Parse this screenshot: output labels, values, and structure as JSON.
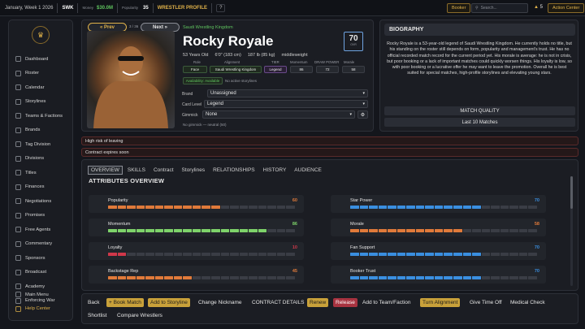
{
  "topbar": {
    "date": "January, Week 1 2026",
    "promotion": "SWK",
    "money_label": "Money",
    "money_value": "$30.0M",
    "popularity_label": "Popularity",
    "popularity_value": "35",
    "section": "WRESTLER PROFILE",
    "help": "?",
    "booker": "Booker",
    "search_placeholder": "Search...",
    "notif_count": "5",
    "action_center": "Action Center"
  },
  "sidebar": {
    "items": [
      {
        "label": "Dashboard",
        "icon": "home-icon"
      },
      {
        "label": "Roster",
        "icon": "roster-icon"
      },
      {
        "label": "Calendar",
        "icon": "calendar-icon"
      },
      {
        "label": "Storylines",
        "icon": "storylines-icon"
      },
      {
        "label": "Teams & Factions",
        "icon": "teams-icon"
      },
      {
        "label": "Brands",
        "icon": "brands-icon"
      },
      {
        "label": "Tag Division",
        "icon": "tag-icon"
      },
      {
        "label": "Divisions",
        "icon": "divisions-icon"
      },
      {
        "label": "Titles",
        "icon": "titles-icon"
      },
      {
        "label": "Finances",
        "icon": "finances-icon"
      },
      {
        "label": "Negotiations",
        "icon": "negotiations-icon"
      },
      {
        "label": "Promises",
        "icon": "promises-icon"
      },
      {
        "label": "Free Agents",
        "icon": "free-agents-icon"
      },
      {
        "label": "Commentary",
        "icon": "commentary-icon"
      },
      {
        "label": "Sponsors",
        "icon": "sponsors-icon"
      },
      {
        "label": "Broadcast",
        "icon": "broadcast-icon"
      },
      {
        "label": "Academy",
        "icon": "academy-icon"
      },
      {
        "label": "Enforcing War",
        "icon": "war-icon"
      }
    ],
    "main_menu": "Main Menu",
    "help_center": "Help Center"
  },
  "profile": {
    "prev": "« Prev",
    "counter": "3 / 36",
    "next": "Next »",
    "promotion": "Saudi Wrestling Kingdom",
    "name": "Rocky Royale",
    "ovr_value": "70",
    "ovr_label": "OVR",
    "age": "53 Years Old",
    "height": "6'0\" (183 cm)",
    "weight": "187 lb (85 kg)",
    "weight_class": "middleweight",
    "labels": {
      "role": "Role",
      "alignment": "Alignment",
      "tier": "TIER",
      "momentum": "Momentum",
      "draw_power": "DRAW POWER",
      "morale": "Morale"
    },
    "role": "Face",
    "alignment": "Saudi Wrestling Kingdom",
    "tier": "Legend",
    "momentum": "86",
    "draw_power": "72",
    "morale": "58",
    "availability": "Availability: Available",
    "storylines": "No active storylines",
    "brand_label": "Brand",
    "brand_value": "Unassigned",
    "card_level_label": "Card Level",
    "card_level_value": "Legend",
    "gimmick_label": "Gimmick",
    "gimmick_value": "None",
    "gimmick_note": "No gimmick — neutral (50)"
  },
  "biography": {
    "title": "BIOGRAPHY",
    "text": "Rocky Royale is a 53-year-old legend of Saudi Wrestling Kingdom. He currently holds no title, but his standing on the roster still depends on form, popularity and management's trust. He has no official recorded match record for the current period yet. His morale is average: he is not in crisis, but poor booking or a lack of important matches could quickly worsen things. His loyalty is low, so with poor booking or a lucrative offer he may want to leave the promotion. Overall he is best suited for special matches, high-profile storylines and elevating young stars.",
    "match_quality": "MATCH QUALITY",
    "last_matches": "Last 10 Matches"
  },
  "alerts": [
    "High risk of leaving",
    "Contract expires soon"
  ],
  "tabs": [
    "OVERVIEW",
    "SKILLS",
    "Contract",
    "Storylines",
    "RELATIONSHIPS",
    "HISTORY",
    "AUDIENCE"
  ],
  "attributes": {
    "title": "ATTRIBUTES OVERVIEW",
    "left": [
      {
        "name": "Popularity",
        "value": 60,
        "color": "#e07a3a"
      },
      {
        "name": "Momentum",
        "value": 86,
        "color": "#7ed36a"
      },
      {
        "name": "Loyalty",
        "value": 10,
        "color": "#d0384a"
      },
      {
        "name": "Backstage Rep",
        "value": 45,
        "color": "#e07a3a"
      }
    ],
    "right": [
      {
        "name": "Star Power",
        "value": 70,
        "color": "#3a8fe0"
      },
      {
        "name": "Morale",
        "value": 58,
        "color": "#e07a3a"
      },
      {
        "name": "Fan Support",
        "value": 70,
        "color": "#3a8fe0"
      },
      {
        "name": "Booker Trust",
        "value": 70,
        "color": "#3a8fe0"
      }
    ]
  },
  "actions": {
    "back": "Back",
    "book_match": "+ Book Match",
    "add_storyline": "Add to Storyline",
    "change_nickname": "Change Nickname",
    "contract_details": "CONTRACT DETAILS",
    "renew": "Renew",
    "release": "Release",
    "add_team": "Add to Team/Faction",
    "turn_alignment": "Turn Alignment",
    "give_time_off": "Give Time Off",
    "medical_check": "Medical Check",
    "shortlist": "Shortlist",
    "compare": "Compare Wrestlers"
  }
}
